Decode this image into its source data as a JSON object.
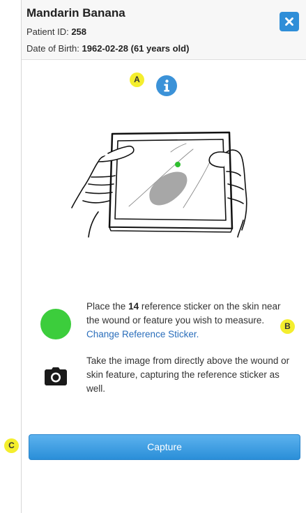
{
  "patient": {
    "name": "Mandarin Banana",
    "id_label": "Patient ID:",
    "id_value": "258",
    "dob_label": "Date of Birth:",
    "dob_value": "1962-02-28 (61 years old)"
  },
  "icons": {
    "close": "close-icon",
    "info": "info-icon",
    "sticker": "sticker-dot-icon",
    "camera": "camera-icon"
  },
  "badges": {
    "a": "A",
    "b": "B",
    "c": "C"
  },
  "instructions": {
    "sticker_prefix": "Place the",
    "sticker_count": "14",
    "sticker_suffix": "reference sticker on the skin near the wound or feature you wish to measure.",
    "change_sticker_link": "Change Reference Sticker.",
    "camera_text": "Take the image from directly above the wound or skin feature, capturing the reference sticker as well."
  },
  "actions": {
    "capture_label": "Capture"
  },
  "colors": {
    "accent": "#2f8ed8",
    "sticker_green": "#3ccd3c",
    "badge_yellow": "#f4ee2e",
    "link": "#2a6ebb"
  }
}
